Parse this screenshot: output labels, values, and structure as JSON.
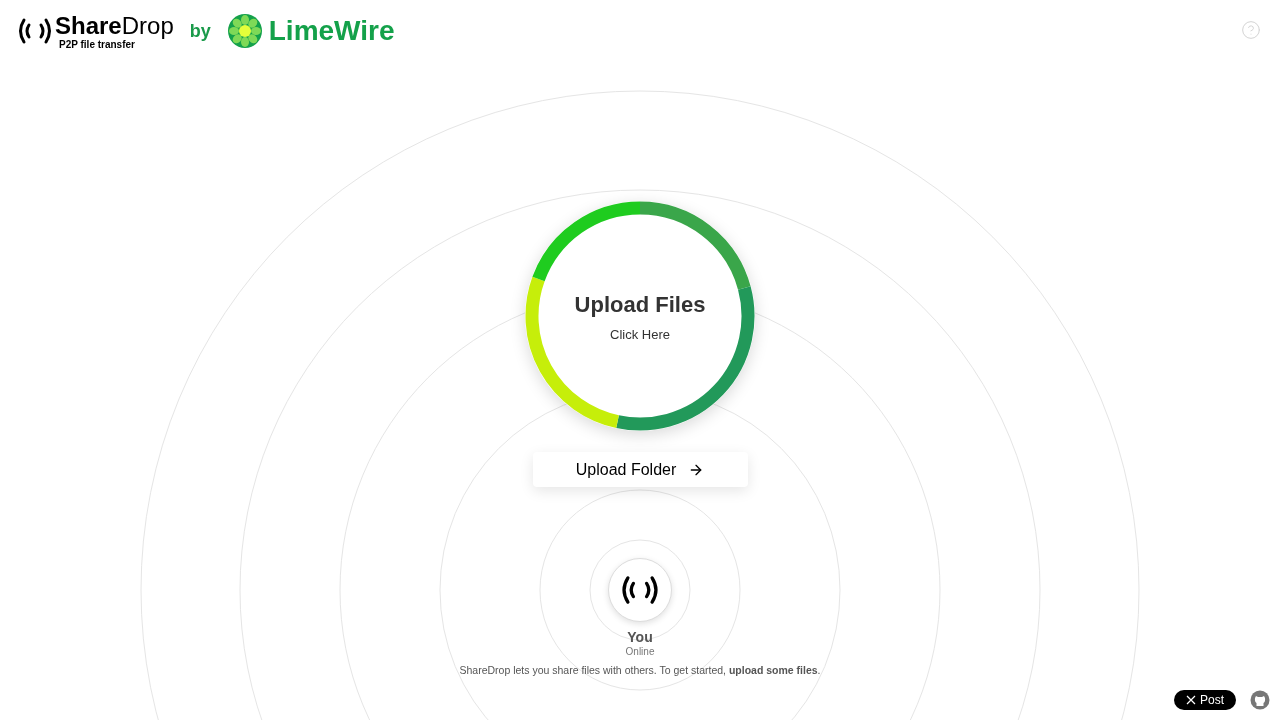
{
  "header": {
    "brand": "**Share**Drop",
    "tagline": "P2P file transfer",
    "by": "by",
    "partner": "LimeWire"
  },
  "upload": {
    "title": "Upload Files",
    "subtitle": "Click Here"
  },
  "folder_button": {
    "label": "Upload Folder"
  },
  "user": {
    "name": "You",
    "status": "Online"
  },
  "info": "ShareDrop lets you share files with others. To get started, **upload some files**.",
  "share_button": {
    "label": "Post"
  }
}
